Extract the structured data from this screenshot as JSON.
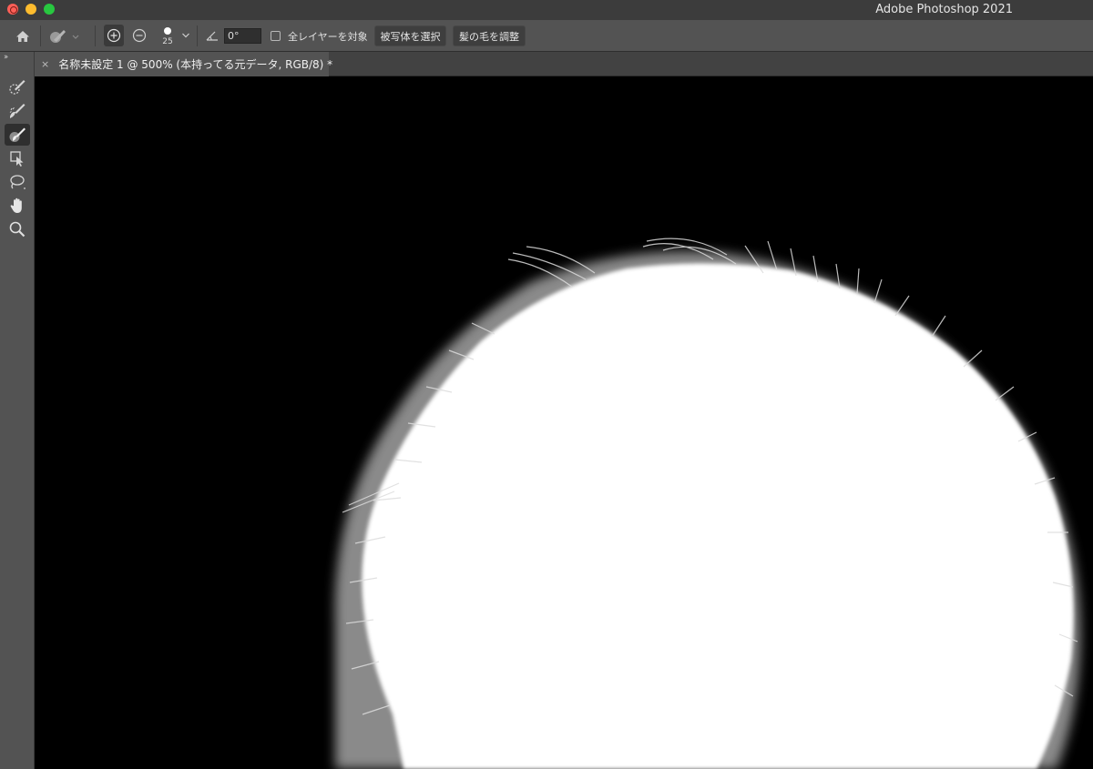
{
  "titlebar": {
    "app_title": "Adobe Photoshop 2021"
  },
  "options_bar": {
    "brush_size": "25",
    "angle_value": "0°",
    "sample_all_layers_label": "全レイヤーを対象",
    "sample_all_layers_checked": false,
    "select_subject_label": "被写体を選択",
    "refine_hair_label": "髪の毛を調整"
  },
  "document_tab": {
    "close_glyph": "×",
    "title": "名称未設定 1 @ 500% (本持ってる元データ, RGB/8) *"
  },
  "toolbar": {
    "collapse_glyph": "››",
    "tools": [
      {
        "name": "quick-selection-tool-icon",
        "active": false
      },
      {
        "name": "refine-edge-brush-tool-icon",
        "active": false
      },
      {
        "name": "brush-tool-icon",
        "active": true
      },
      {
        "name": "object-selection-tool-icon",
        "active": false
      },
      {
        "name": "lasso-tool-icon",
        "active": false
      },
      {
        "name": "hand-tool-icon",
        "active": false
      },
      {
        "name": "zoom-tool-icon",
        "active": false
      }
    ]
  },
  "colors": {
    "panel": "#535353",
    "titlebar": "#3c3c3c",
    "canvas_bg": "#000000",
    "mask_fg": "#ffffff"
  }
}
